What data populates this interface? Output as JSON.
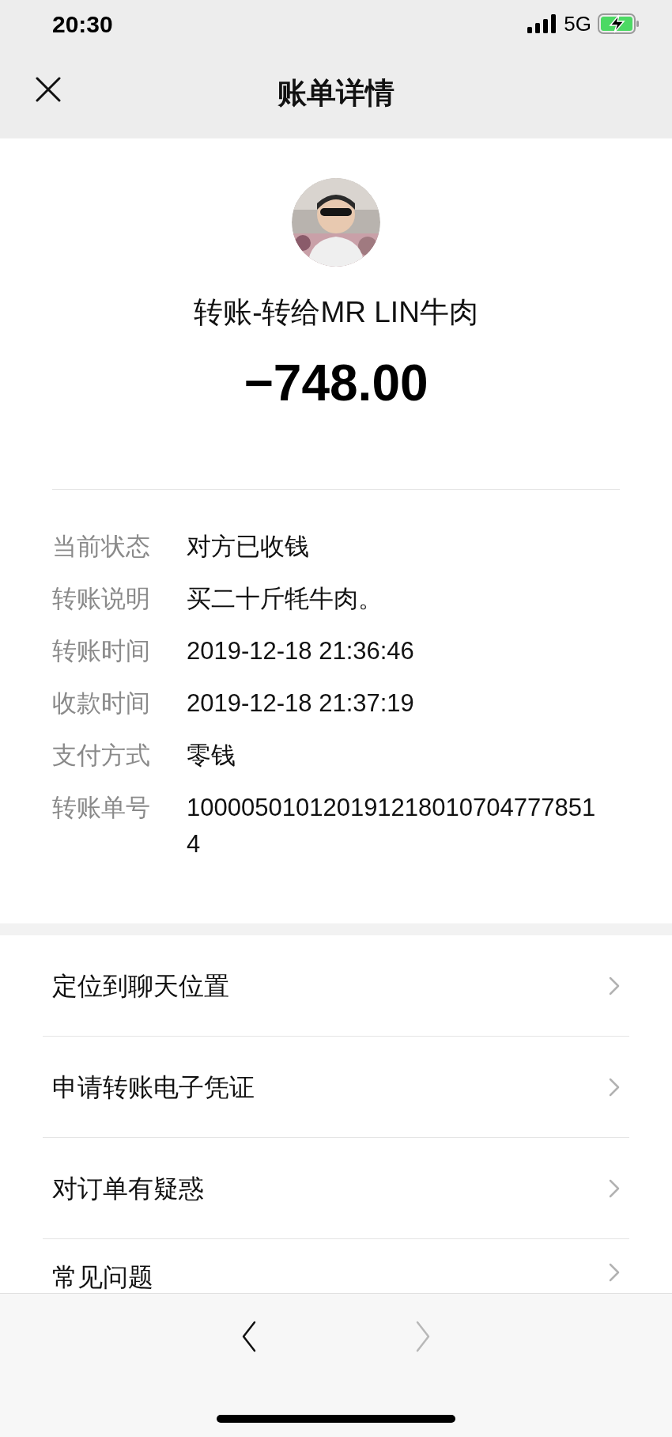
{
  "status_bar": {
    "time": "20:30",
    "network": "5G"
  },
  "nav": {
    "title": "账单详情"
  },
  "header": {
    "title": "转账-转给MR LIN牛肉",
    "amount": "−748.00"
  },
  "details": [
    {
      "label": "当前状态",
      "value": "对方已收钱"
    },
    {
      "label": "转账说明",
      "value": "买二十斤牦牛肉。"
    },
    {
      "label": "转账时间",
      "value": "2019-12-18 21:36:46"
    },
    {
      "label": "收款时间",
      "value": "2019-12-18 21:37:19"
    },
    {
      "label": "支付方式",
      "value": "零钱"
    },
    {
      "label": "转账单号",
      "value": "1000050101201912180107047778514"
    }
  ],
  "actions": [
    {
      "label": "定位到聊天位置"
    },
    {
      "label": "申请转账电子凭证"
    },
    {
      "label": "对订单有疑惑"
    },
    {
      "label": "常见问题"
    }
  ],
  "toolbar": [
    {
      "kind": "back",
      "disabled": false
    },
    {
      "kind": "forward",
      "disabled": true
    }
  ]
}
